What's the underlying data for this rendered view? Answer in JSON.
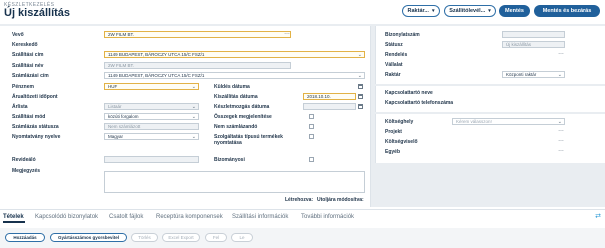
{
  "header": {
    "breadcrumb": "KÉSZLETKEZELÉS",
    "title": "Új kiszállítás",
    "buttons": {
      "raktar": "Raktár...",
      "szallitolevel": "Szállítólevél...",
      "mentes": "Mentés",
      "mentes_bezaras": "Mentés és bezárás"
    }
  },
  "left": {
    "labels": {
      "vevo": "Vevő",
      "kereskedo": "Kereskedő",
      "szallitasi_cim": "Szállítási cím",
      "szallitasi_nev": "Szállítási név",
      "szamlazasi_cim": "Számlázási cím",
      "penznem": "Pénznem",
      "arualtozeti": "Árualtözeti időpont",
      "arlista": "Árlista",
      "szallitasi_mod": "Szállítási mód",
      "szamlazas_statusza": "Számlázás státusza",
      "nyomtatvany_nyelve": "Nyomtatvány nyelve",
      "revidealo": "Revideáló",
      "megjegyzes": "Megjegyzés",
      "kuldes_datuma": "Küldés dátuma",
      "kiszallitas_datuma": "Kiszállítás dátuma",
      "keszletmozgas_datuma": "Készletmozgás dátuma",
      "osszegek": "Összegek megjelenítése",
      "nem_szamlazando": "Nem számlázandó",
      "szolgaltatas": "Szolgáltatás típusú termékek",
      "nyomtatasa": "nyomtatása",
      "bizomanyosi": "Bizományosi"
    },
    "values": {
      "vevo": "2W FILM BT.",
      "szallitasi_cim": "1149 BUDAPEST, BÁROCZY UTCA 15/C FSZ/1",
      "szallitasi_nev": "2W FILM BT.",
      "szamlazasi_cim": "1149 BUDAPEST, BÁROCZY UTCA 15/C FSZ/1",
      "penznem": "HUF",
      "arlista": "Listaár",
      "szallitasi_mod": "közúti forgalom",
      "szamlazas_statusza": "Nem számlázott",
      "nyomtatvany_nyelve": "Magyar",
      "kiszallitas_datuma": "2018.10.10."
    },
    "footer_links": {
      "letrehozva": "Létrehozva:",
      "utoljara": "Utoljára módosítva:"
    }
  },
  "right": {
    "labels": {
      "bizonylatszam": "Bizonylatszám",
      "statusz": "Státusz",
      "rendeles": "Rendelés",
      "vallalat": "Vállalat",
      "raktar": "Raktár",
      "kapcs_neve": "Kapcsolattartó neve",
      "kapcs_telefon": "Kapcsolattartó telefonszáma",
      "koltseghely": "Költséghely",
      "projekt": "Projekt",
      "koltsegviselo": "Költségviselő",
      "egyeb": "Egyéb"
    },
    "values": {
      "statusz": "Új kiszállítás",
      "raktar": "Központi raktár",
      "koltseghely_placeholder": "Kérem válasszon!"
    }
  },
  "tabs": [
    "Tételek",
    "Kapcsolódó bizonylatok",
    "Csatolt fájlok",
    "Receptúra komponensek",
    "Szállítási információk",
    "További információk"
  ],
  "actions": {
    "hozzaadas": "Hozzáadás",
    "gyorsbevitel": "Gyártásszámos gyorsbevitel",
    "torles": "Törlés",
    "excel_export": "Excel Export",
    "fel": "Fel",
    "le": "Le"
  }
}
